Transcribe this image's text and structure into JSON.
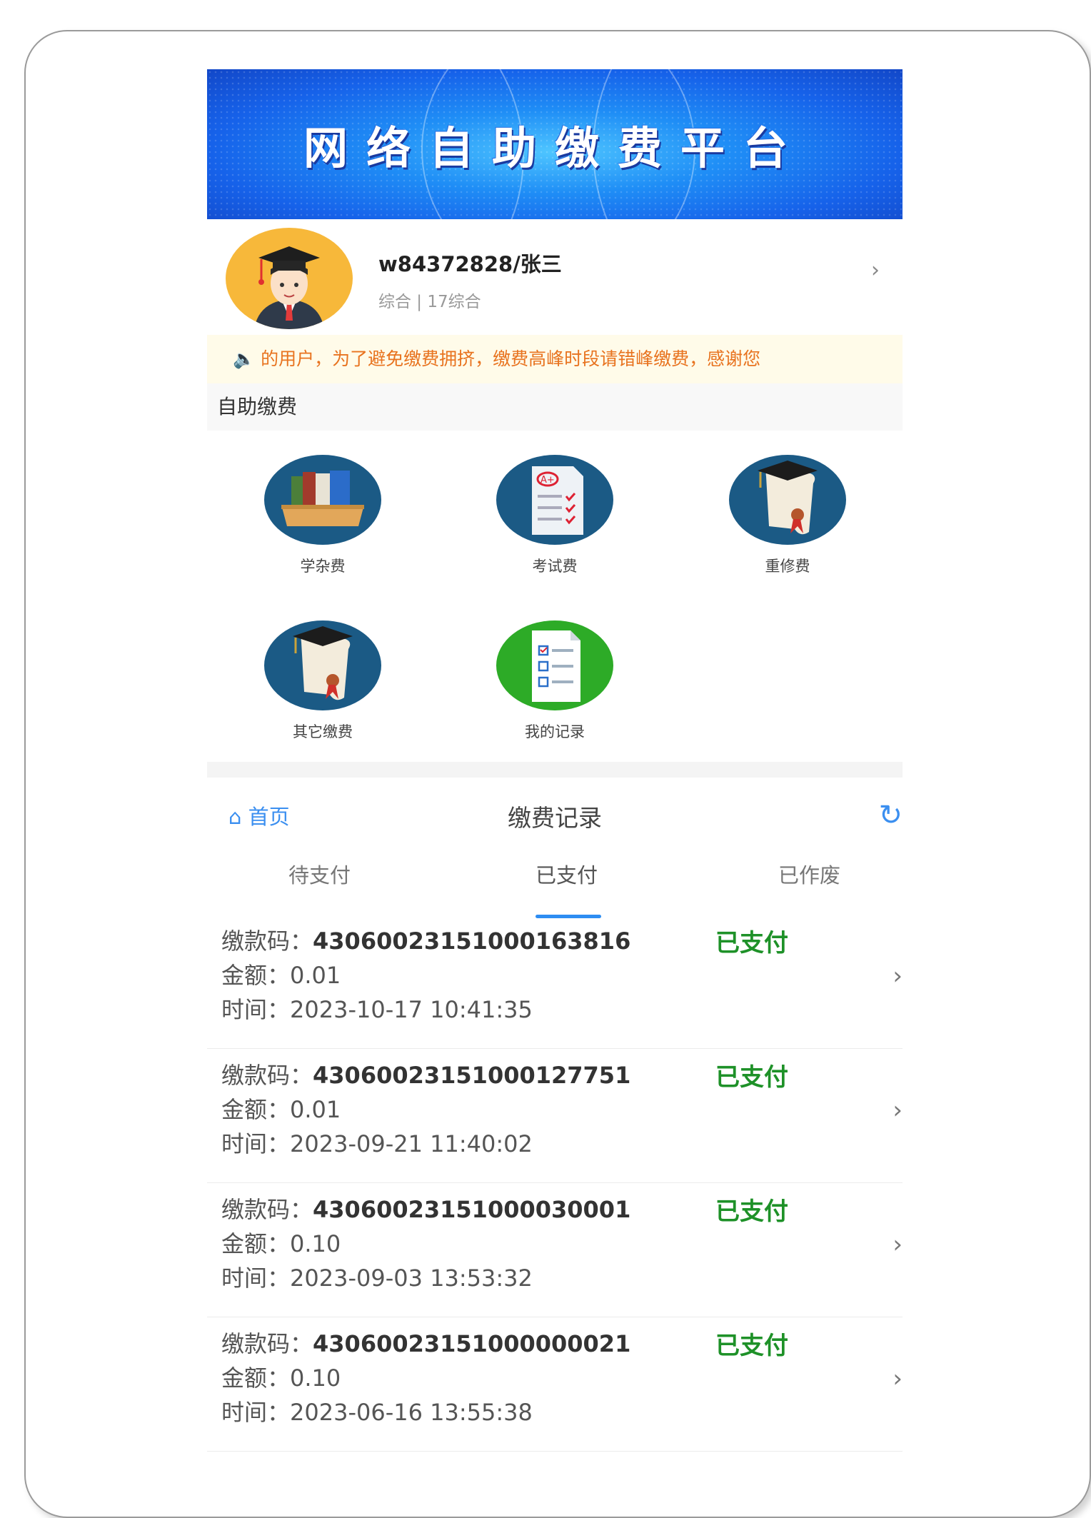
{
  "banner": {
    "title": "网络自助缴费平台"
  },
  "profile": {
    "username": "w84372828/张三",
    "info": "综合 | 17综合"
  },
  "notice": {
    "icon": "speaker-icon",
    "text": "的用户，为了避免缴费拥挤，缴费高峰时段请错峰缴费，感谢您"
  },
  "self_service": {
    "title": "自助缴费",
    "items": [
      {
        "label": "学杂费",
        "icon": "books-icon"
      },
      {
        "label": "考试费",
        "icon": "exam-paper-icon"
      },
      {
        "label": "重修费",
        "icon": "diploma-icon"
      },
      {
        "label": "其它缴费",
        "icon": "diploma-icon"
      },
      {
        "label": "我的记录",
        "icon": "checklist-icon"
      }
    ]
  },
  "records_header": {
    "home_label": "首页",
    "title": "缴费记录"
  },
  "tabs": [
    {
      "label": "待支付"
    },
    {
      "label": "已支付",
      "active": true
    },
    {
      "label": "已作废"
    }
  ],
  "labels": {
    "code": "缴款码：",
    "amount": "金额：",
    "time": "时间："
  },
  "records": [
    {
      "code": "43060023151000163816",
      "status": "已支付",
      "amount": "0.01",
      "time": "2023-10-17 10:41:35"
    },
    {
      "code": "43060023151000127751",
      "status": "已支付",
      "amount": "0.01",
      "time": "2023-09-21 11:40:02"
    },
    {
      "code": "43060023151000030001",
      "status": "已支付",
      "amount": "0.10",
      "time": "2023-09-03 13:53:32"
    },
    {
      "code": "43060023151000000021",
      "status": "已支付",
      "amount": "0.10",
      "time": "2023-06-16 13:55:38"
    }
  ],
  "colors": {
    "accent": "#2d8df2",
    "paid": "#1e9128",
    "notice": "#e8731f"
  }
}
